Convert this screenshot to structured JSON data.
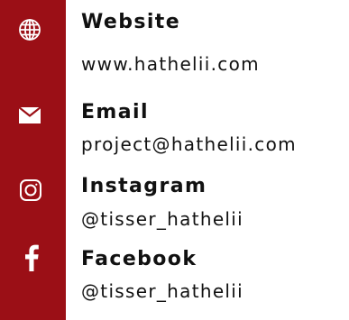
{
  "colors": {
    "accent": "#9b0f16",
    "text": "#111111",
    "icon": "#ffffff"
  },
  "contacts": [
    {
      "label": "Website",
      "value": "www.hathelii.com",
      "icon": "globe-icon"
    },
    {
      "label": "Email",
      "value": "project@hathelii.com",
      "icon": "envelope-icon"
    },
    {
      "label": "Instagram",
      "value": "@tisser_hathelii",
      "icon": "instagram-icon"
    },
    {
      "label": "Facebook",
      "value": "@tisser_hathelii",
      "icon": "facebook-icon"
    }
  ]
}
